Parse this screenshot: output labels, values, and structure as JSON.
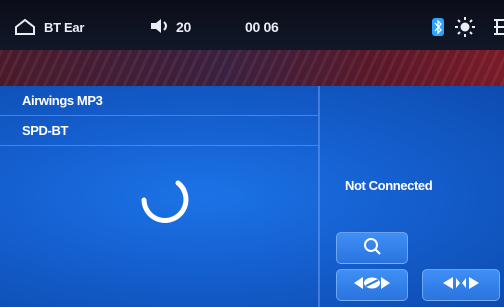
{
  "status_bar": {
    "source": "BT Ear",
    "volume": "20",
    "time": "00 06",
    "icons": [
      "home-icon",
      "speaker-icon",
      "bluetooth-icon",
      "brightness-icon"
    ]
  },
  "device_list": [
    "Airwings MP3",
    "SPD-BT"
  ],
  "connection_status": "Not Connected",
  "buttons": {
    "search_icon": "search-icon",
    "prev_icon": "connect-icon",
    "next_icon": "disconnect-icon"
  },
  "colors": {
    "screen_blue": "#1767d8",
    "stripe_red": "#5a1828",
    "button_blue": "#3584ee"
  }
}
